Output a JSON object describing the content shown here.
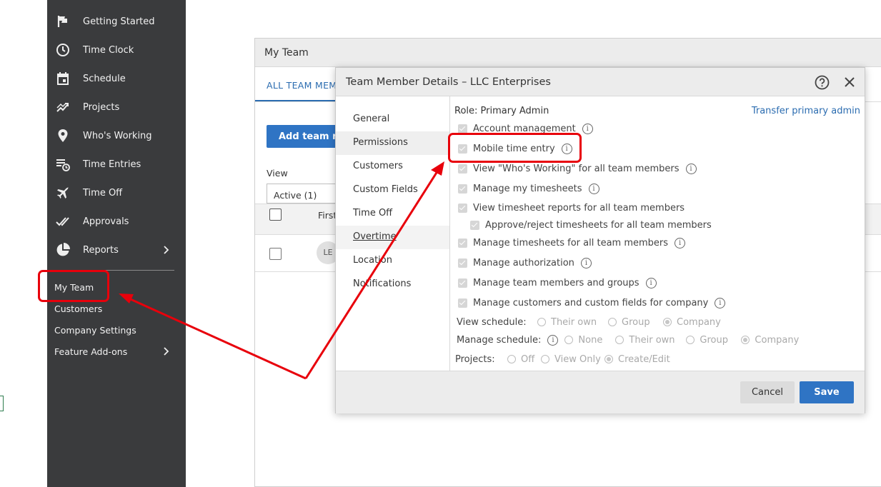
{
  "sidebar": {
    "items": [
      {
        "label": "Getting Started",
        "icon": "flag-icon"
      },
      {
        "label": "Time Clock",
        "icon": "clock-icon"
      },
      {
        "label": "Schedule",
        "icon": "calendar-icon"
      },
      {
        "label": "Projects",
        "icon": "trend-icon"
      },
      {
        "label": "Who's Working",
        "icon": "location-pin-icon"
      },
      {
        "label": "Time Entries",
        "icon": "list-clock-icon"
      },
      {
        "label": "Time Off",
        "icon": "airplane-icon"
      },
      {
        "label": "Approvals",
        "icon": "double-check-icon"
      },
      {
        "label": "Reports",
        "icon": "pie-chart-icon"
      }
    ],
    "sub_items": [
      {
        "label": "My Team"
      },
      {
        "label": "Customers"
      },
      {
        "label": "Company Settings"
      },
      {
        "label": "Feature Add-ons"
      }
    ]
  },
  "my_team": {
    "title": "My Team",
    "tab_all": "ALL TEAM MEM",
    "add_button": "Add team me",
    "view_label": "View",
    "view_value": "Active (1)",
    "col_first": "First",
    "avatar_initials": "LE"
  },
  "modal": {
    "title": "Team Member Details – LLC Enterprises",
    "nav": [
      "General",
      "Permissions",
      "Customers",
      "Custom Fields",
      "Time Off",
      "Overtime",
      "Location",
      "Notifications"
    ],
    "role": "Role: Primary Admin",
    "transfer_link": "Transfer primary admin",
    "permissions": [
      {
        "label": "Account management",
        "info": true
      },
      {
        "label": "Mobile time entry",
        "info": true
      },
      {
        "label": "View \"Who's Working\" for all team members",
        "info": true
      },
      {
        "label": "Manage my timesheets",
        "info": true
      },
      {
        "label": "View timesheet reports for all team members",
        "info": false
      },
      {
        "label": "Approve/reject timesheets for all team members",
        "info": false
      },
      {
        "label": "Manage timesheets for all team members",
        "info": true
      },
      {
        "label": "Manage authorization",
        "info": true
      },
      {
        "label": "Manage team members and groups",
        "info": true
      },
      {
        "label": "Manage customers and custom fields for company",
        "info": true
      }
    ],
    "view_schedule": {
      "label": "View schedule:",
      "options": [
        "Their own",
        "Group",
        "Company"
      ],
      "selected": "Company"
    },
    "manage_schedule": {
      "label": "Manage schedule:",
      "options": [
        "None",
        "Their own",
        "Group",
        "Company"
      ],
      "selected": "Company"
    },
    "projects": {
      "label": "Projects:",
      "options": [
        "Off",
        "View Only",
        "Create/Edit"
      ],
      "selected": "Create/Edit"
    },
    "cancel": "Cancel",
    "save": "Save"
  },
  "colors": {
    "sidebar_bg": "#3a3b3d",
    "accent": "#2f74c4",
    "highlight": "#e8000b"
  }
}
